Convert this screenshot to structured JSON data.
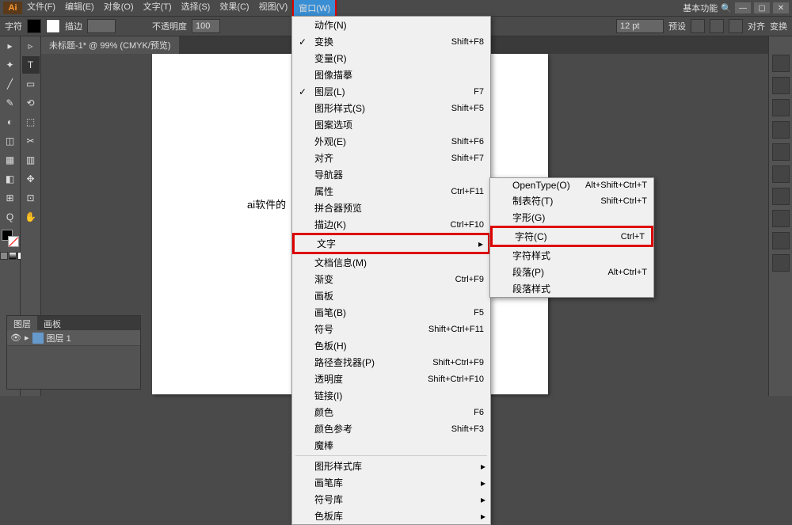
{
  "logo": "Ai",
  "menu": {
    "file": "文件(F)",
    "edit": "编辑(E)",
    "object": "对象(O)",
    "text": "文字(T)",
    "select": "选择(S)",
    "effect": "效果(C)",
    "view": "视图(V)",
    "window": "窗口(W)"
  },
  "title_right": {
    "basic": "基本功能"
  },
  "controlbar": {
    "label": "字符",
    "stroke": "描边",
    "opacity_label": "不透明度",
    "opacity_val": "100",
    "pt": "12 pt",
    "prefs": "预设",
    "align": "对齐",
    "transform": "变换"
  },
  "doctab": "未标题-1* @ 99% (CMYK/预览)",
  "canvas_text": "ai软件的",
  "window_menu": [
    {
      "label": "动作(N)",
      "shortcut": ""
    },
    {
      "label": "变换",
      "shortcut": "Shift+F8",
      "checked": true
    },
    {
      "label": "变量(R)",
      "shortcut": ""
    },
    {
      "label": "图像描摹",
      "shortcut": ""
    },
    {
      "label": "图层(L)",
      "shortcut": "F7",
      "checked": true
    },
    {
      "label": "图形样式(S)",
      "shortcut": "Shift+F5"
    },
    {
      "label": "图案选项",
      "shortcut": ""
    },
    {
      "label": "外观(E)",
      "shortcut": "Shift+F6"
    },
    {
      "label": "对齐",
      "shortcut": "Shift+F7"
    },
    {
      "label": "导航器",
      "shortcut": ""
    },
    {
      "label": "属性",
      "shortcut": "Ctrl+F11"
    },
    {
      "label": "拼合器预览",
      "shortcut": ""
    },
    {
      "label": "描边(K)",
      "shortcut": "Ctrl+F10"
    },
    {
      "label": "文字",
      "shortcut": "",
      "highlight": true,
      "arrow": true
    },
    {
      "label": "文档信息(M)",
      "shortcut": ""
    },
    {
      "label": "渐变",
      "shortcut": "Ctrl+F9"
    },
    {
      "label": "画板",
      "shortcut": ""
    },
    {
      "label": "画笔(B)",
      "shortcut": "F5"
    },
    {
      "label": "符号",
      "shortcut": "Shift+Ctrl+F11"
    },
    {
      "label": "色板(H)",
      "shortcut": ""
    },
    {
      "label": "路径查找器(P)",
      "shortcut": "Shift+Ctrl+F9"
    },
    {
      "label": "透明度",
      "shortcut": "Shift+Ctrl+F10"
    },
    {
      "label": "链接(I)",
      "shortcut": ""
    },
    {
      "label": "颜色",
      "shortcut": "F6"
    },
    {
      "label": "颜色参考",
      "shortcut": "Shift+F3"
    },
    {
      "label": "魔棒",
      "shortcut": ""
    },
    {
      "sep": true
    },
    {
      "label": "图形样式库",
      "shortcut": "",
      "arrow": true
    },
    {
      "label": "画笔库",
      "shortcut": "",
      "arrow": true
    },
    {
      "label": "符号库",
      "shortcut": "",
      "arrow": true
    },
    {
      "label": "色板库",
      "shortcut": "",
      "arrow": true
    }
  ],
  "text_submenu": [
    {
      "label": "OpenType(O)",
      "shortcut": "Alt+Shift+Ctrl+T"
    },
    {
      "label": "制表符(T)",
      "shortcut": "Shift+Ctrl+T"
    },
    {
      "label": "字形(G)",
      "shortcut": ""
    },
    {
      "label": "字符(C)",
      "shortcut": "Ctrl+T",
      "highlight": true
    },
    {
      "label": "字符样式",
      "shortcut": ""
    },
    {
      "label": "段落(P)",
      "shortcut": "Alt+Ctrl+T"
    },
    {
      "label": "段落样式",
      "shortcut": ""
    }
  ],
  "layers": {
    "tab1": "图层",
    "tab2": "画板",
    "row": "图层 1"
  },
  "tools_left": [
    "▸",
    "▹",
    "✦",
    "T",
    "╱",
    "▭",
    "✎",
    "⟲",
    "◐",
    "⬚",
    "◫",
    "✂",
    "▦",
    "▥",
    "◧",
    "✥",
    "⊞",
    "⊡",
    "Q",
    "✋"
  ],
  "tools_right": [
    "◉",
    "◐",
    "≡",
    "◫",
    "⬚",
    "Aa",
    "◧",
    "✦",
    "⊞",
    "⊡"
  ]
}
